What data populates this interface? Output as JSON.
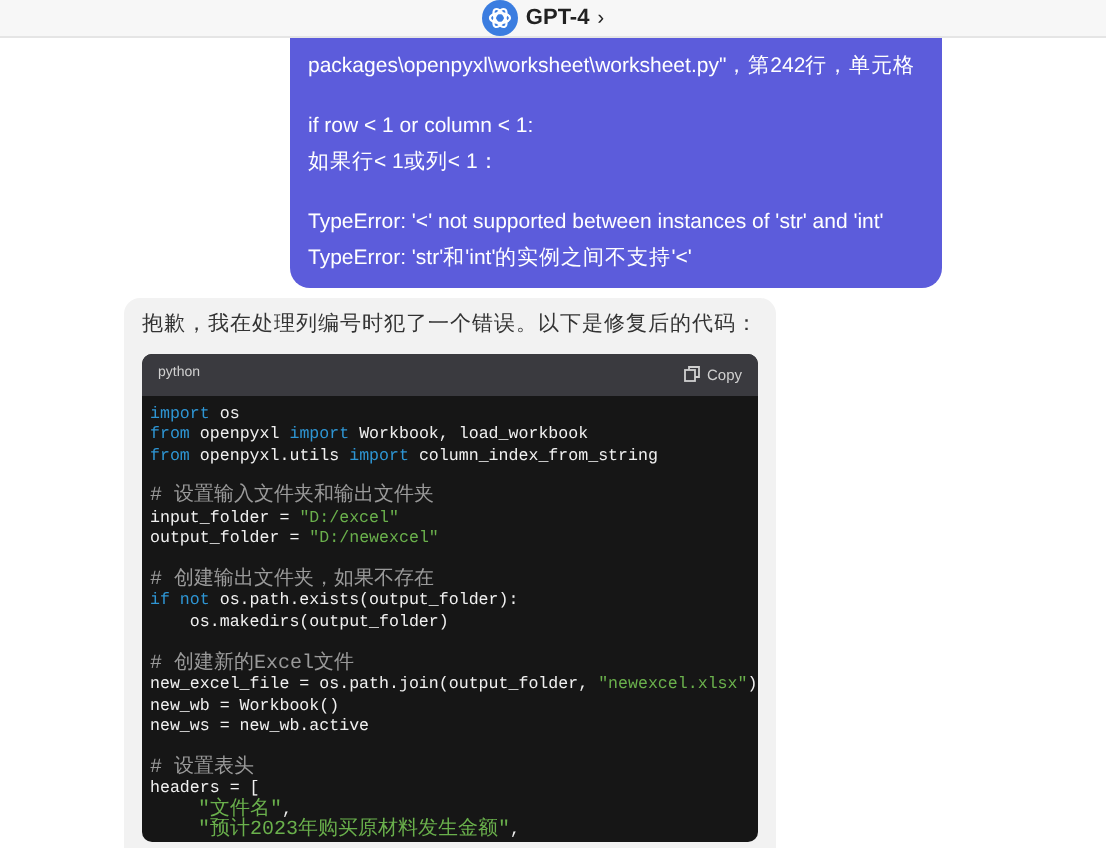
{
  "header": {
    "model": "GPT-4",
    "chevron": "›"
  },
  "user_message": {
    "paragraphs": [
      [
        "packages\\openpyxl\\worksheet\\worksheet.py\"，第242行，单元格"
      ],
      [
        "if row < 1 or column < 1:",
        "如果行< 1或列< 1："
      ],
      [
        "TypeError: '<' not supported between instances of 'str' and 'int'",
        "TypeError: 'str'和'int'的实例之间不支持'<'"
      ]
    ]
  },
  "assistant_message": {
    "text": "抱歉，我在处理列编号时犯了一个错误。以下是修复后的代码：",
    "code_block": {
      "language": "python",
      "copy_label": "Copy",
      "blocks": [
        [
          [
            {
              "kind": "keyword",
              "text": "import"
            },
            {
              "kind": "plain",
              "text": " os"
            }
          ],
          [
            {
              "kind": "keyword",
              "text": "from"
            },
            {
              "kind": "plain",
              "text": " openpyxl "
            },
            {
              "kind": "keyword",
              "text": "import"
            },
            {
              "kind": "plain",
              "text": " Workbook, load_workbook"
            }
          ],
          [
            {
              "kind": "keyword",
              "text": "from"
            },
            {
              "kind": "plain",
              "text": " openpyxl.utils "
            },
            {
              "kind": "keyword",
              "text": "import"
            },
            {
              "kind": "plain",
              "text": " column_index_from_string"
            }
          ]
        ],
        [
          [
            {
              "kind": "comment",
              "text": "# 设置输入文件夹和输出文件夹"
            }
          ],
          [
            {
              "kind": "plain",
              "text": "input_folder = "
            },
            {
              "kind": "string",
              "text": "\"D:/excel\""
            }
          ],
          [
            {
              "kind": "plain",
              "text": "output_folder = "
            },
            {
              "kind": "string",
              "text": "\"D:/newexcel\""
            }
          ]
        ],
        [
          [
            {
              "kind": "comment",
              "text": "# 创建输出文件夹，如果不存在"
            }
          ],
          [
            {
              "kind": "keyword",
              "text": "if not"
            },
            {
              "kind": "plain",
              "text": " os.path.exists(output_folder):"
            }
          ],
          [
            {
              "kind": "plain",
              "text": "    os.makedirs(output_folder)"
            }
          ]
        ],
        [
          [
            {
              "kind": "comment",
              "text": "# 创建新的Excel文件"
            }
          ],
          [
            {
              "kind": "plain",
              "text": "new_excel_file = os.path.join(output_folder, "
            },
            {
              "kind": "string",
              "text": "\"newexcel.xlsx\""
            },
            {
              "kind": "plain",
              "text": ")"
            }
          ],
          [
            {
              "kind": "plain",
              "text": "new_wb = Workbook()"
            }
          ],
          [
            {
              "kind": "plain",
              "text": "new_ws = new_wb.active"
            }
          ]
        ],
        [
          [
            {
              "kind": "comment",
              "text": "# 设置表头"
            }
          ],
          [
            {
              "kind": "plain",
              "text": "headers = ["
            }
          ],
          [
            {
              "kind": "string",
              "text": "    \"文件名\""
            },
            {
              "kind": "plain",
              "text": ","
            }
          ],
          [
            {
              "kind": "string",
              "text": "    \"预计2023年购买原材料发生金额\""
            },
            {
              "kind": "plain",
              "text": ","
            }
          ]
        ]
      ]
    }
  }
}
